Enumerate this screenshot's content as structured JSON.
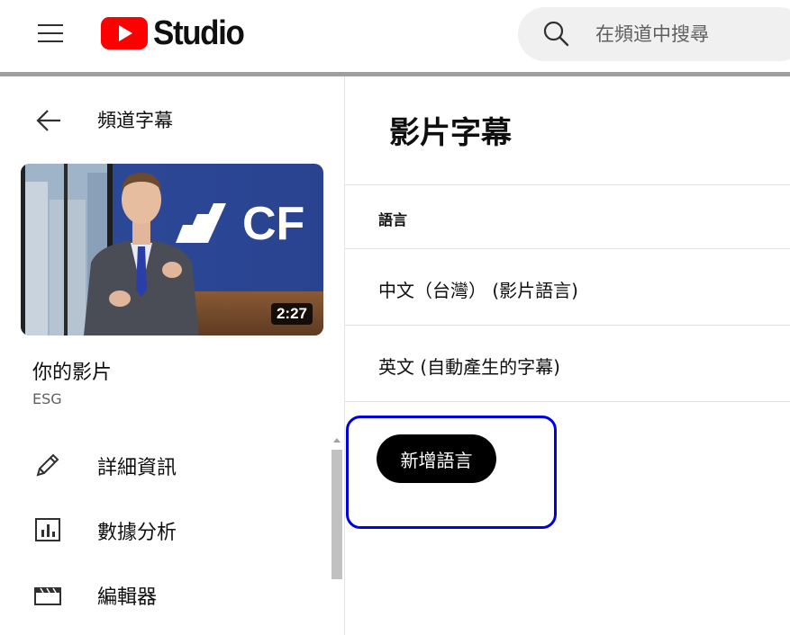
{
  "header": {
    "logo_text": "Studio",
    "search_placeholder": "在頻道中搜尋"
  },
  "sidebar": {
    "back_label": "頻道字幕",
    "video": {
      "duration": "2:27",
      "title": "你的影片",
      "subtitle": "ESG",
      "thumbnail_brand": "CF"
    },
    "nav": [
      {
        "label": "詳細資訊",
        "icon": "pencil-icon"
      },
      {
        "label": "數據分析",
        "icon": "analytics-icon"
      },
      {
        "label": "編輯器",
        "icon": "clapperboard-icon"
      }
    ]
  },
  "main": {
    "title": "影片字幕",
    "column_header": "語言",
    "languages": [
      {
        "label": "中文（台灣） (影片語言)"
      },
      {
        "label": "英文 (自動產生的字幕)"
      }
    ],
    "add_button": "新增語言"
  },
  "colors": {
    "brand_red": "#ff0000",
    "highlight_border": "#0000e0",
    "button_bg": "#000000"
  }
}
